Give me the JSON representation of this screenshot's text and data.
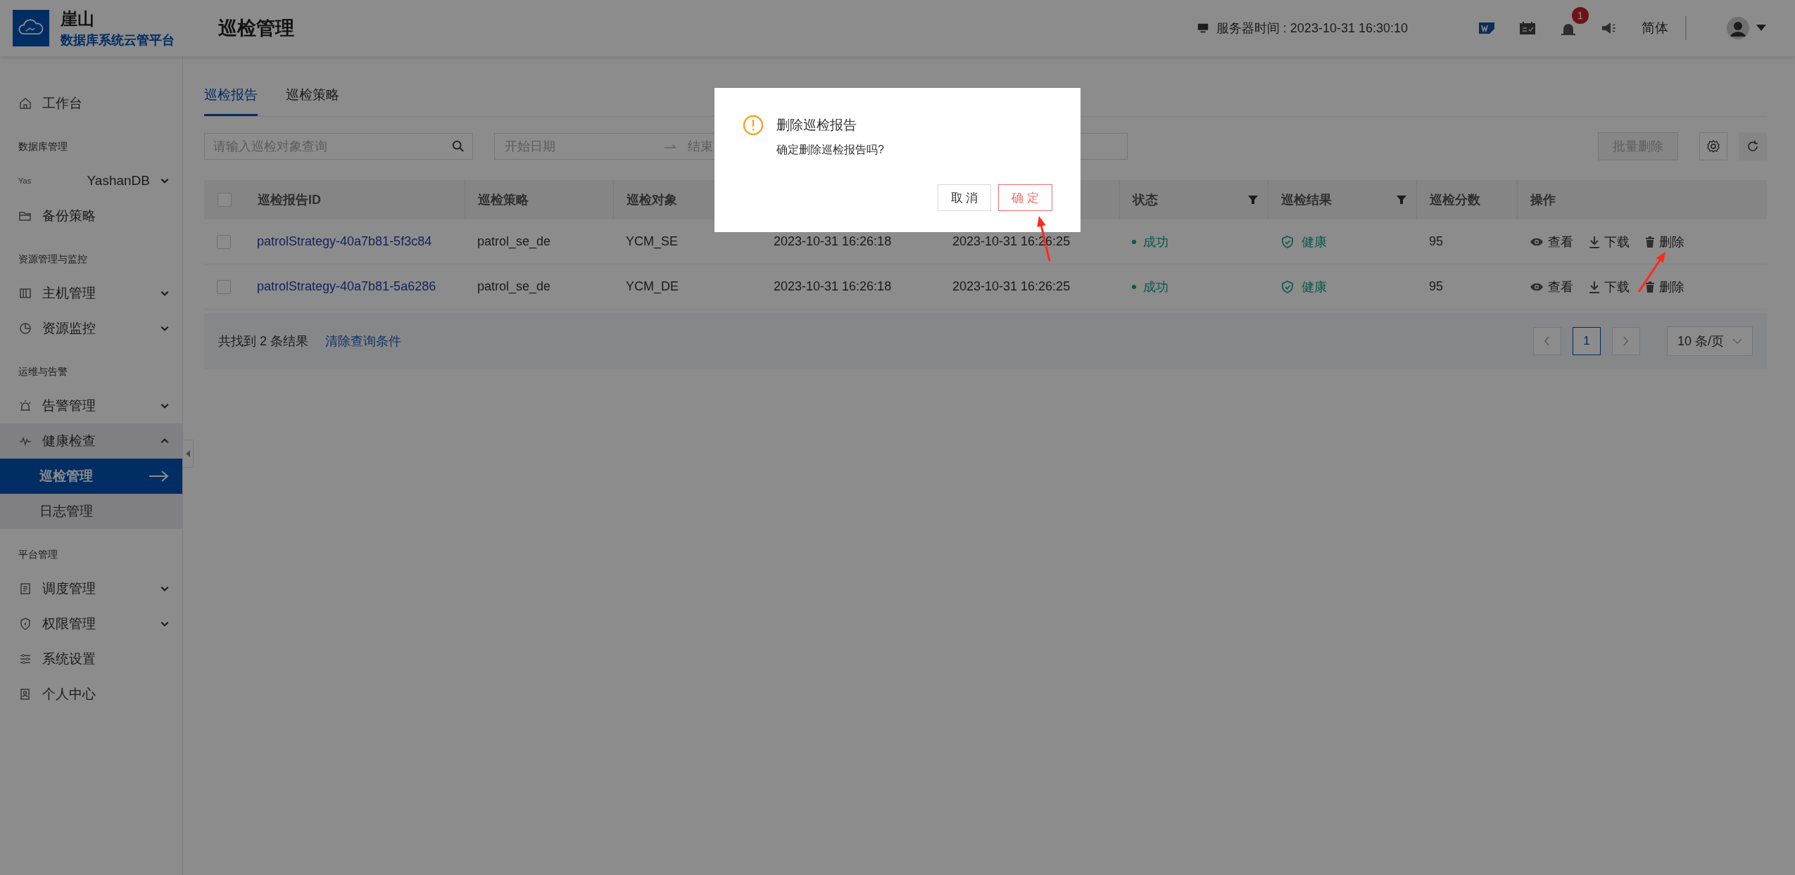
{
  "header": {
    "brand": "崖山",
    "brand_subtitle": "数据库系统云管平台",
    "page_title": "巡检管理",
    "server_time": "服务器时间 : 2023-10-31 16:30:10",
    "notification_count": "1",
    "language": "简体"
  },
  "sidebar": {
    "items": [
      {
        "kind": "item",
        "label": "工作台"
      },
      {
        "kind": "section",
        "label": "数据库管理"
      },
      {
        "kind": "item",
        "label": "YashanDB",
        "logo_text": "Yas",
        "expanded": false
      },
      {
        "kind": "item",
        "label": "备份策略"
      },
      {
        "kind": "section",
        "label": "资源管理与监控"
      },
      {
        "kind": "item",
        "label": "主机管理",
        "expanded": false
      },
      {
        "kind": "item",
        "label": "资源监控",
        "expanded": false
      },
      {
        "kind": "section",
        "label": "运维与告警"
      },
      {
        "kind": "item",
        "label": "告警管理",
        "expanded": false
      },
      {
        "kind": "item",
        "label": "健康检查",
        "expanded": true,
        "children": [
          {
            "label": "巡检管理",
            "selected": true
          },
          {
            "label": "日志管理",
            "selected": false
          }
        ]
      },
      {
        "kind": "section",
        "label": "平台管理"
      },
      {
        "kind": "item",
        "label": "调度管理",
        "expanded": false
      },
      {
        "kind": "item",
        "label": "权限管理",
        "expanded": false
      },
      {
        "kind": "item",
        "label": "系统设置"
      },
      {
        "kind": "item",
        "label": "个人中心"
      }
    ]
  },
  "tabs": [
    {
      "label": "巡检报告",
      "selected": true
    },
    {
      "label": "巡检策略",
      "selected": false
    }
  ],
  "filters": {
    "search_placeholder": "请输入巡检对象查询",
    "start_placeholder": "开始日期",
    "end_placeholder": "结束",
    "batch_delete": "批量删除"
  },
  "table": {
    "select_all_checked": false,
    "columns": [
      {
        "label": "巡检报告ID"
      },
      {
        "label": "巡检策略"
      },
      {
        "label": "巡检对象"
      },
      {},
      {},
      {
        "label": "状态",
        "filter": true
      },
      {
        "label": "巡检结果",
        "filter": true
      },
      {
        "label": "巡检分数"
      },
      {
        "label": "操作"
      }
    ],
    "rows": [
      {
        "checked": false,
        "id": "patrolStrategy-40a7b81-5f3c84",
        "strategy": "patrol_se_de",
        "target": "YCM_SE",
        "column_4": "2023-10-31 16:26:18",
        "column_5": "2023-10-31 16:26:25",
        "status": "成功",
        "result": "健康",
        "score": "95",
        "actions": [
          "查看",
          "下载",
          "删除"
        ]
      },
      {
        "checked": false,
        "id": "patrolStrategy-40a7b81-5a6286",
        "strategy": "patrol_se_de",
        "target": "YCM_DE",
        "column_4": "2023-10-31 16:26:18",
        "column_5": "2023-10-31 16:26:25",
        "status": "成功",
        "result": "健康",
        "score": "95",
        "actions": [
          "查看",
          "下载",
          "删除"
        ]
      }
    ]
  },
  "footer": {
    "found_prefix": "共找到",
    "found_count": "2",
    "found_suffix": "条结果",
    "clear": "清除查询条件",
    "pages": [
      {
        "label": "1",
        "selected": true
      }
    ],
    "page_size": "10 条/页"
  },
  "dialog": {
    "title": "删除巡检报告",
    "message": "确定删除巡检报告吗?",
    "buttons": [
      {
        "label": "取 消",
        "kind": "default"
      },
      {
        "label": "确 定",
        "kind": "primary"
      }
    ]
  },
  "annotations": [
    {
      "kind": "arrow"
    },
    {
      "kind": "arrow"
    }
  ]
}
